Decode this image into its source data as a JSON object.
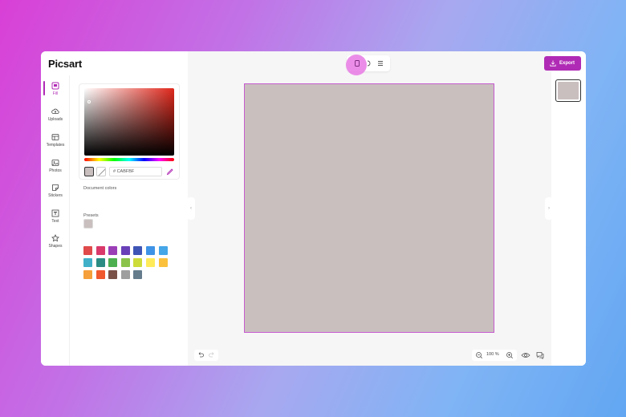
{
  "app": {
    "logo": "Picsart"
  },
  "rail": {
    "items": [
      {
        "label": "Fill",
        "icon": "fill-icon",
        "active": true
      },
      {
        "label": "Uploads",
        "icon": "cloud-upload-icon"
      },
      {
        "label": "Templates",
        "icon": "templates-icon"
      },
      {
        "label": "Photos",
        "icon": "photos-icon"
      },
      {
        "label": "Stickers",
        "icon": "stickers-icon"
      },
      {
        "label": "Text",
        "icon": "text-icon"
      },
      {
        "label": "Shapes",
        "icon": "shapes-icon"
      }
    ]
  },
  "color_panel": {
    "hex_value": "# CABFBF",
    "current_color": "#cabfbf",
    "document_colors_title": "Document colors",
    "document_colors": [
      "#cabfbf"
    ],
    "presets_title": "Presets",
    "presets": [
      "#e04a4a",
      "#d93a6a",
      "#9b3fb6",
      "#6a40b8",
      "#3f55b5",
      "#3e93e6",
      "#45a6e8",
      "#3fb0c8",
      "#2b8c84",
      "#4caf50",
      "#8bc34a",
      "#cddc39",
      "#ffeb5a",
      "#fbc13d",
      "#f5a03a",
      "#f0582d",
      "#7a5248",
      "#9e9e9e",
      "#647c8c"
    ]
  },
  "canvas": {
    "fill_color": "#cabfbf",
    "border_color": "#c65ad0",
    "zoom": "100 %"
  },
  "pages": {
    "thumbnail_color": "#cabfbf"
  },
  "toolbar": {
    "export_label": "Export"
  },
  "colors": {
    "accent": "#b02bb5"
  }
}
